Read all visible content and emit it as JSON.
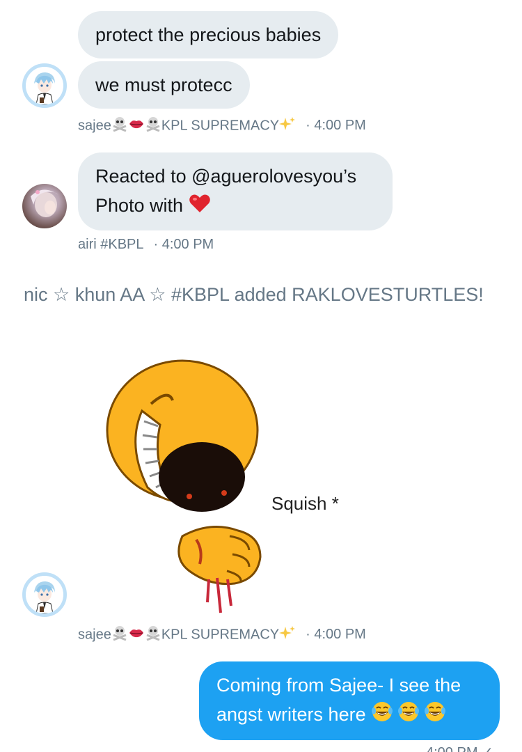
{
  "messages": [
    {
      "text_1": "protect the precious babies",
      "text_2": "we must protecc",
      "sender": "sajee",
      "sender_suffix": "KPL SUPREMACY",
      "time": "4:00 PM"
    },
    {
      "text_line1": "Reacted to @aguerolovesyou’s",
      "text_line2": "Photo with",
      "sender": "airi #KBPL",
      "time": "4:00 PM"
    },
    {
      "system": "nic ☆ khun AA ☆ #KBPL added RAKLOVESTURTLES!"
    },
    {
      "image_caption": "Squish *",
      "sender": "sajee",
      "sender_suffix": "KPL SUPREMACY",
      "time": "4:00 PM"
    },
    {
      "text_line1": "Coming from Sajee- I see the",
      "text_line2": "angst writers here",
      "time": "4:00 PM"
    }
  ],
  "icons": {
    "skull": "skull-crossbones-icon",
    "lips": "lips-icon",
    "sparkles": "sparkles-icon",
    "heart": "red-heart-icon",
    "laugh": "tears-of-joy-icon"
  },
  "colors": {
    "bubble_in": "#e6ecf0",
    "bubble_out": "#1da1f2",
    "meta": "#657786"
  }
}
